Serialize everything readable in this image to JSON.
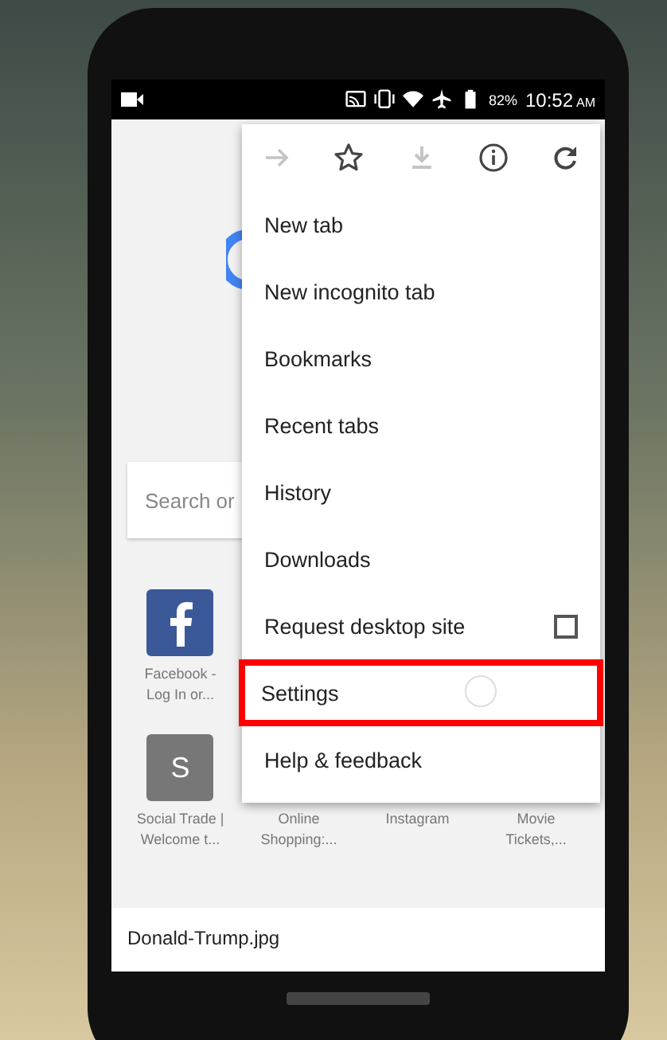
{
  "status_bar": {
    "icons": [
      {
        "kind": "cast"
      },
      {
        "kind": "vibrate"
      },
      {
        "kind": "wifi"
      },
      {
        "kind": "airplane"
      },
      {
        "kind": "battery"
      }
    ],
    "battery": "82%",
    "time": "10:52",
    "meridiem": "AM"
  },
  "search": {
    "placeholder": "Search or"
  },
  "tiles": [
    {
      "kind": "facebook",
      "label": "Facebook - Log In or..."
    },
    {
      "kind": "hidden"
    },
    {
      "kind": "hidden"
    },
    {
      "kind": "hidden"
    },
    {
      "kind": "letter",
      "letter": "S",
      "label": "Social Trade | Welcome t..."
    },
    {
      "kind": "shopping",
      "label": "Online Shopping:..."
    },
    {
      "kind": "instagram",
      "label": "Instagram"
    },
    {
      "kind": "movie",
      "label": "Movie Tickets,..."
    }
  ],
  "download_card": {
    "title": "Donald-Trump.jpg"
  },
  "menu": {
    "actions": [
      {
        "kind": "forward",
        "disabled": true
      },
      {
        "kind": "star",
        "disabled": false
      },
      {
        "kind": "download",
        "disabled": true
      },
      {
        "kind": "info",
        "disabled": false
      },
      {
        "kind": "refresh",
        "disabled": false
      }
    ],
    "items": [
      {
        "label": "New tab",
        "kind": "plain",
        "highlighted": false
      },
      {
        "label": "New incognito tab",
        "kind": "plain",
        "highlighted": false
      },
      {
        "label": "Bookmarks",
        "kind": "plain",
        "highlighted": false
      },
      {
        "label": "Recent tabs",
        "kind": "plain",
        "highlighted": false
      },
      {
        "label": "History",
        "kind": "plain",
        "highlighted": false
      },
      {
        "label": "Downloads",
        "kind": "plain",
        "highlighted": false
      },
      {
        "label": "Request desktop site",
        "kind": "checkbox",
        "checked": false,
        "highlighted": false
      },
      {
        "label": "Settings",
        "kind": "plain",
        "highlighted": true,
        "pressed": true
      },
      {
        "label": "Help & feedback",
        "kind": "plain",
        "highlighted": false
      }
    ]
  }
}
